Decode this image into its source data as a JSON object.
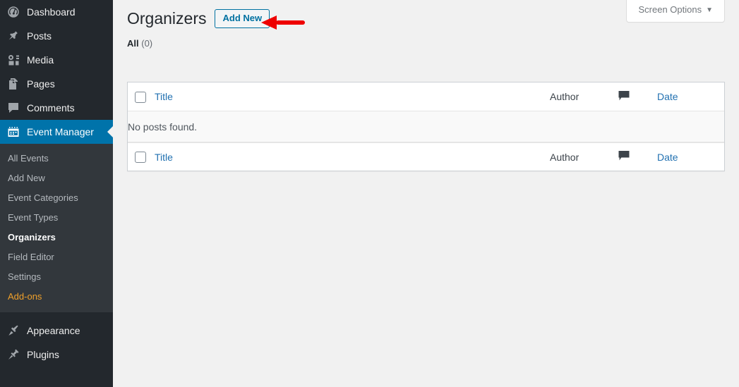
{
  "colors": {
    "menu_bg": "#23282d",
    "submenu_bg": "#32373c",
    "accent_blue": "#0073aa",
    "link_blue": "#2271b1",
    "addons_orange": "#f0a02a",
    "content_bg": "#f1f1f1",
    "annotation_red": "#ee0000"
  },
  "sidebar": {
    "items": [
      {
        "label": "Dashboard",
        "icon": "dashboard-icon",
        "current": false
      },
      {
        "label": "Posts",
        "icon": "pin-icon",
        "current": false
      },
      {
        "label": "Media",
        "icon": "media-icon",
        "current": false
      },
      {
        "label": "Pages",
        "icon": "pages-icon",
        "current": false
      },
      {
        "label": "Comments",
        "icon": "comment-icon",
        "current": false
      },
      {
        "label": "Event Manager",
        "icon": "calendar-icon",
        "current": true
      },
      {
        "label": "Appearance",
        "icon": "paintbrush-icon",
        "current": false
      },
      {
        "label": "Plugins",
        "icon": "plug-icon",
        "current": false
      }
    ],
    "submenu": [
      {
        "label": "All Events",
        "current": false,
        "highlight": false
      },
      {
        "label": "Add New",
        "current": false,
        "highlight": false
      },
      {
        "label": "Event Categories",
        "current": false,
        "highlight": false
      },
      {
        "label": "Event Types",
        "current": false,
        "highlight": false
      },
      {
        "label": "Organizers",
        "current": true,
        "highlight": false
      },
      {
        "label": "Field Editor",
        "current": false,
        "highlight": false
      },
      {
        "label": "Settings",
        "current": false,
        "highlight": false
      },
      {
        "label": "Add-ons",
        "current": false,
        "highlight": true
      }
    ]
  },
  "screen_meta": {
    "screen_options_label": "Screen Options",
    "caret": "▼"
  },
  "header": {
    "title": "Organizers",
    "add_new_label": "Add New"
  },
  "filters": {
    "all_label": "All",
    "all_count": "(0)"
  },
  "table": {
    "columns": {
      "title": "Title",
      "author": "Author",
      "comments_icon": "comment-bubble-icon",
      "date": "Date"
    },
    "empty_message": "No posts found.",
    "rows": []
  }
}
